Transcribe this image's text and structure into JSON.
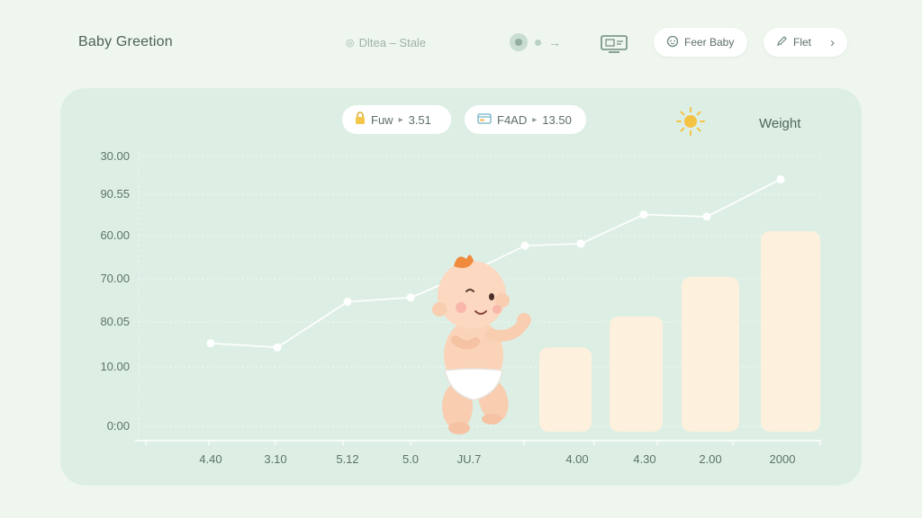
{
  "header": {
    "title": "Baby Greetion",
    "status": {
      "icon": "clock-icon",
      "text": "Dltea – Stale"
    },
    "pills": [
      {
        "icon": "baby-face-icon",
        "label": "Feer Baby"
      },
      {
        "icon": "pencil-icon",
        "label": "Flet",
        "trailing_icon": "chevron-right-icon"
      }
    ]
  },
  "chips": [
    {
      "icon": "lock-icon",
      "name": "Fuw",
      "value": "3.51"
    },
    {
      "icon": "card-icon",
      "name": "F4AD",
      "value": "13.50"
    }
  ],
  "weather_icon": "sun-icon",
  "colors": {
    "background": "#eef6ee",
    "panel": "#ddefe5",
    "line": "#ffffff",
    "bar": "#fdf0dc",
    "sun": "#f5c242",
    "accent_hair": "#f08a3c"
  },
  "chart_data": {
    "type": "bar",
    "series_label": "Weight",
    "y_tick_labels": [
      "30.00",
      "90.55",
      "60.00",
      "70.00",
      "80.05",
      "10.00",
      "0:00"
    ],
    "x_tick_labels": [
      "4.40",
      "3.10",
      "5.12",
      "5.0",
      "JU.7",
      "4.00",
      "4.30",
      "2.00",
      "2000"
    ],
    "grid": true,
    "line_series": {
      "name": "Weight",
      "points": [
        {
          "x": "4.40",
          "y": 2.0
        },
        {
          "x": "3.10",
          "y": 1.9
        },
        {
          "x": "5.12",
          "y": 3.0
        },
        {
          "x": "5.0",
          "y": 3.1
        },
        {
          "x": "JU.7",
          "y": 3.7
        },
        {
          "x": "4.00",
          "y": 4.35
        },
        {
          "x": "4.30",
          "y": 4.4
        },
        {
          "x": "2.00",
          "y": 5.1
        },
        {
          "x": "2000",
          "y": 5.05
        },
        {
          "x": "end",
          "y": 5.95
        }
      ]
    },
    "bar_series": [
      {
        "x": "4.00",
        "value": 1.7
      },
      {
        "x": "4.30",
        "value": 2.45
      },
      {
        "x": "2.00",
        "value": 3.4
      },
      {
        "x": "2000",
        "value": 4.5
      }
    ],
    "value_range": [
      0,
      6.5
    ]
  }
}
